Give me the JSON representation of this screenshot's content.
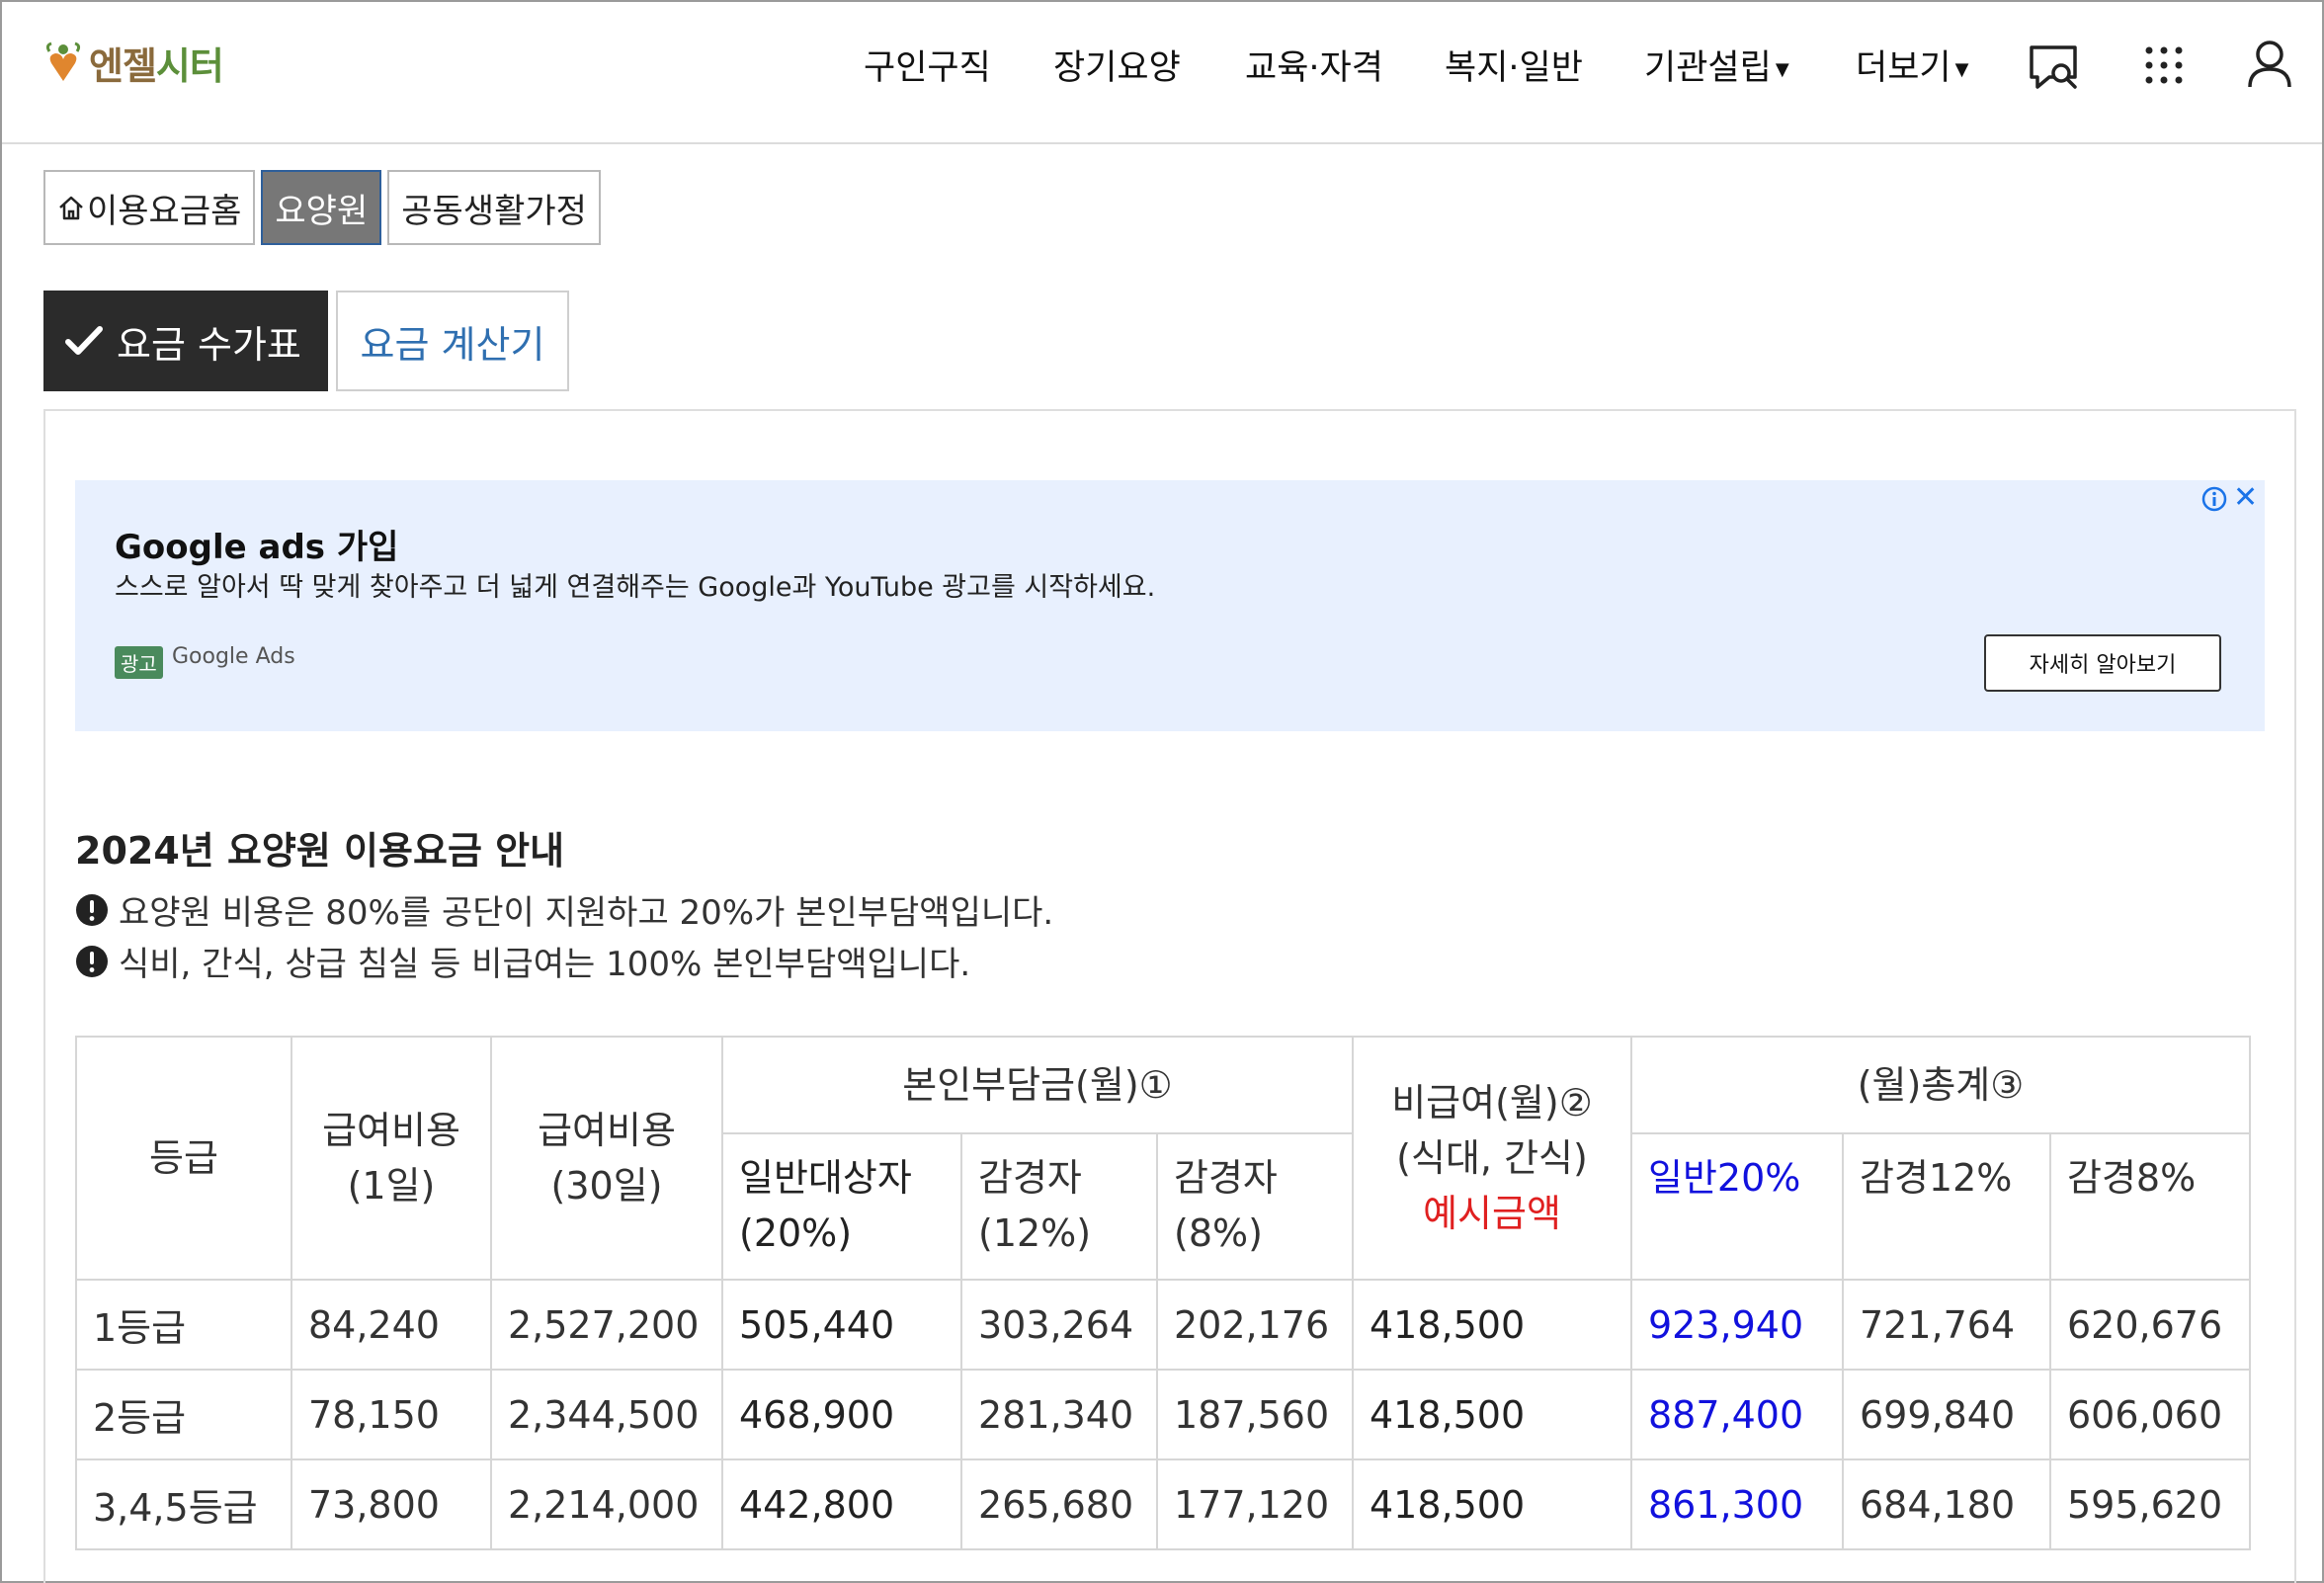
{
  "header": {
    "logo_part1": "엔젤",
    "logo_part2": "시터",
    "nav": [
      {
        "label": "구인구직"
      },
      {
        "label": "장기요양"
      },
      {
        "label": "교육·자격"
      },
      {
        "label": "복지·일반"
      },
      {
        "label": "기관설립"
      },
      {
        "label": "더보기"
      }
    ],
    "icons": [
      "chat-search-icon",
      "apps-grid-icon",
      "user-icon"
    ]
  },
  "subtabs": [
    {
      "label": "이용요금홈",
      "icon": "home-icon"
    },
    {
      "label": "요양원",
      "active": true
    },
    {
      "label": "공동생활가정"
    }
  ],
  "maintabs": [
    {
      "label": "요금 수가표",
      "active": true,
      "icon": "check-icon"
    },
    {
      "label": "요금 계산기"
    }
  ],
  "ad": {
    "title": "Google ads 가입",
    "description": "스스로 알아서 딱 맞게 찾아주고 더 넓게 연결해주는 Google과 YouTube 광고를 시작하세요.",
    "badge": "광고",
    "source": "Google Ads",
    "button": "자세히 알아보기"
  },
  "section": {
    "title": "2024년 요양원 이용요금 안내",
    "notices": [
      "요양원 비용은 80%를 공단이 지원하고 20%가 본인부담액입니다.",
      "식비, 간식, 상급 침실 등 비급여는 100% 본인부담액입니다."
    ]
  },
  "table": {
    "headers": {
      "grade": "등급",
      "daily": [
        "급여비용",
        "(1일)"
      ],
      "monthly": [
        "급여비용",
        "(30일)"
      ],
      "copay_group": "본인부담금(월)①",
      "copay_general": [
        "일반대상자",
        "(20%)"
      ],
      "copay_12": [
        "감경자",
        "(12%)"
      ],
      "copay_8": [
        "감경자",
        "(8%)"
      ],
      "nonpay": [
        "비급여(월)②",
        "(식대, 간식)",
        "예시금액"
      ],
      "total_group": "(월)총계③",
      "total_general": "일반20%",
      "total_12": "감경12%",
      "total_8": "감경8%"
    },
    "rows": [
      [
        "1등급",
        "84,240",
        "2,527,200",
        "505,440",
        "303,264",
        "202,176",
        "418,500",
        "923,940",
        "721,764",
        "620,676"
      ],
      [
        "2등급",
        "78,150",
        "2,344,500",
        "468,900",
        "281,340",
        "187,560",
        "418,500",
        "887,400",
        "699,840",
        "606,060"
      ],
      [
        "3,4,5등급",
        "73,800",
        "2,214,000",
        "442,800",
        "265,680",
        "177,120",
        "418,500",
        "861,300",
        "684,180",
        "595,620"
      ]
    ]
  }
}
